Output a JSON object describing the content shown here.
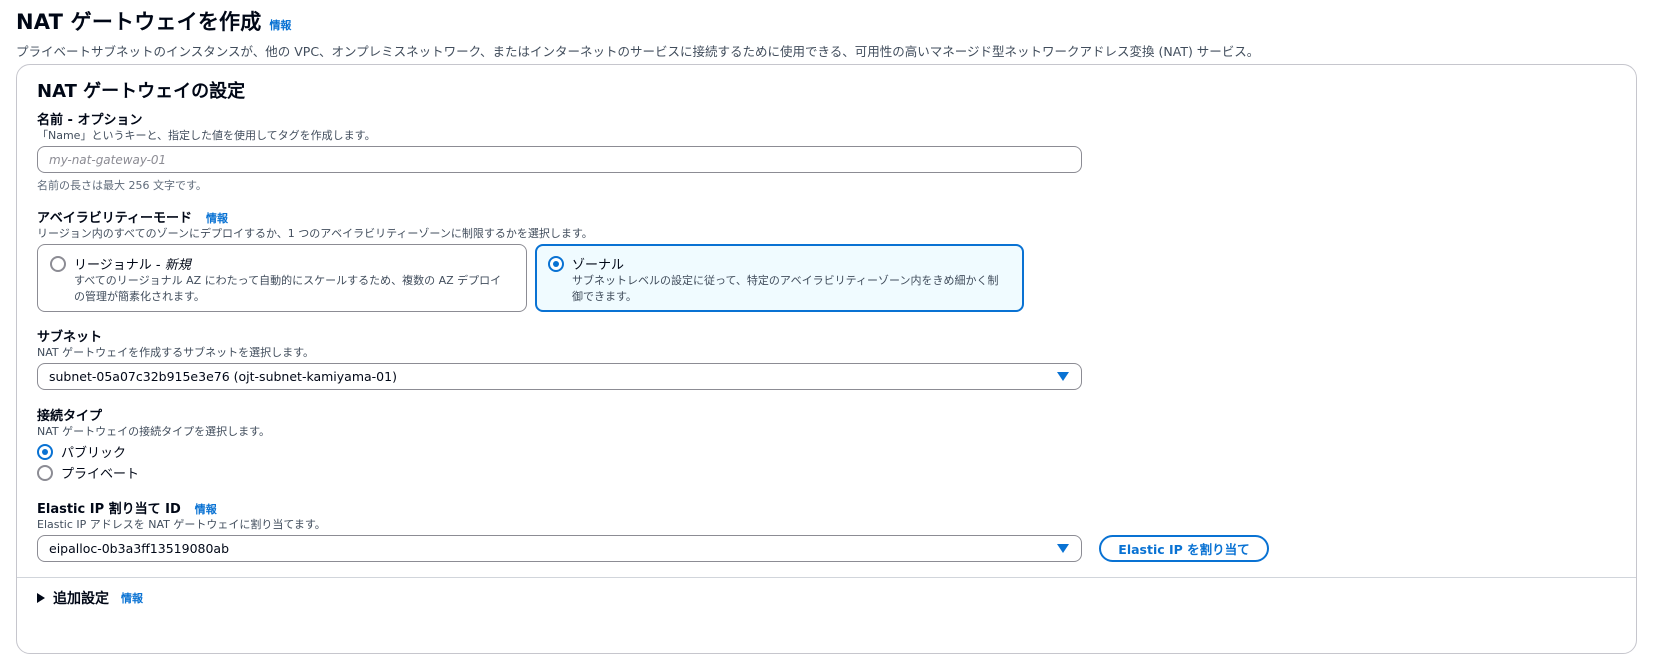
{
  "header": {
    "title": "NAT ゲートウェイを作成",
    "info_label": "情報",
    "description": "プライベートサブネットのインスタンスが、他の VPC、オンプレミスネットワーク、またはインターネットのサービスに接続するために使用できる、可用性の高いマネージド型ネットワークアドレス変換 (NAT) サービス。"
  },
  "panel": {
    "title": "NAT ゲートウェイの設定",
    "name_field": {
      "label": "名前 - オプション",
      "description": "「Name」というキーと、指定した値を使用してタグを作成します。",
      "placeholder": "my-nat-gateway-01",
      "value": "",
      "constraint": "名前の長さは最大 256 文字です。"
    },
    "availability_mode": {
      "label": "アベイラビリティーモード",
      "info_label": "情報",
      "description": "リージョン内のすべてのゾーンにデプロイするか、1 つのアベイラビリティーゾーンに制限するかを選択します。",
      "options": [
        {
          "title": "リージョナル - ",
          "title_suffix": "新規",
          "description": "すべてのリージョナル AZ にわたって自動的にスケールするため、複数の AZ デプロイの管理が簡素化されます。",
          "selected": false
        },
        {
          "title": "ゾーナル",
          "description": "サブネットレベルの設定に従って、特定のアベイラビリティーゾーン内をきめ細かく制御できます。",
          "selected": true
        }
      ]
    },
    "subnet": {
      "label": "サブネット",
      "description": "NAT ゲートウェイを作成するサブネットを選択します。",
      "selected": "subnet-05a07c32b915e3e76 (ojt-subnet-kamiyama-01)"
    },
    "connectivity": {
      "label": "接続タイプ",
      "description": "NAT ゲートウェイの接続タイプを選択します。",
      "options": [
        {
          "label": "パブリック",
          "selected": true
        },
        {
          "label": "プライベート",
          "selected": false
        }
      ]
    },
    "elastic_ip": {
      "label": "Elastic IP 割り当て ID",
      "info_label": "情報",
      "description": "Elastic IP アドレスを NAT ゲートウェイに割り当てます。",
      "selected": "eipalloc-0b3a3ff13519080ab",
      "button_label": "Elastic IP を割り当て"
    },
    "additional": {
      "label": "追加設定",
      "info_label": "情報"
    }
  },
  "colors": {
    "accent": "#0972d3",
    "selected_tile_bg": "#f0fbff",
    "border": "#8c8c94"
  }
}
